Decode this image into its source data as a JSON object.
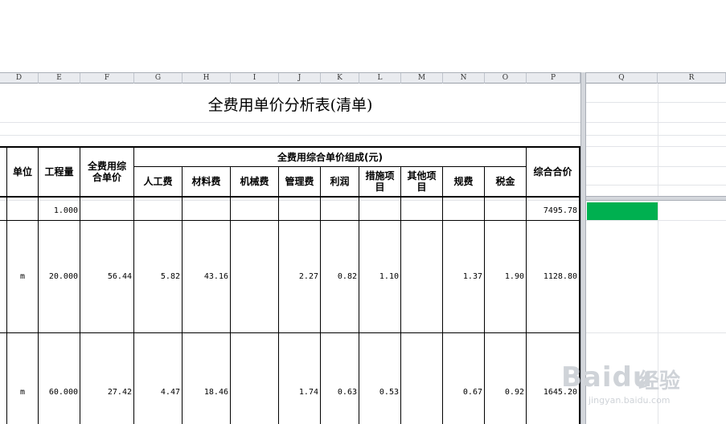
{
  "sheet": {
    "columns_left": [
      "D",
      "E",
      "F",
      "G",
      "H",
      "I",
      "J",
      "K",
      "L",
      "M",
      "N",
      "O",
      "P"
    ],
    "columns_right": [
      "Q",
      "R"
    ],
    "title": "全费用单价分析表(清单)",
    "headers": {
      "unit": "单位",
      "quantity": "工程量",
      "full_unit_price": "全费用综合单价",
      "composition_group": "全费用综合单价组成(元)",
      "labor": "人工费",
      "material": "材料费",
      "machinery": "机械费",
      "management": "管理费",
      "profit": "利润",
      "measures": "措施项目",
      "other": "其他项目",
      "fees": "规费",
      "tax": "税金",
      "total": "综合合价"
    },
    "rows": [
      {
        "unit": "",
        "quantity": "1.000",
        "full_unit_price": "",
        "labor": "",
        "material": "",
        "machinery": "",
        "management": "",
        "profit": "",
        "measures": "",
        "other": "",
        "fees": "",
        "tax": "",
        "total": "7495.78"
      },
      {
        "unit": "m",
        "quantity": "20.000",
        "full_unit_price": "56.44",
        "labor": "5.82",
        "material": "43.16",
        "machinery": "",
        "management": "2.27",
        "profit": "0.82",
        "measures": "1.10",
        "other": "",
        "fees": "1.37",
        "tax": "1.90",
        "total": "1128.80"
      },
      {
        "unit": "m",
        "quantity": "60.000",
        "full_unit_price": "27.42",
        "labor": "4.47",
        "material": "18.46",
        "machinery": "",
        "management": "1.74",
        "profit": "0.63",
        "measures": "0.53",
        "other": "",
        "fees": "0.67",
        "tax": "0.92",
        "total": "1645.20"
      }
    ],
    "selected_cell_color": "#00b050"
  },
  "watermark": {
    "logo": "Baidu",
    "cn": "经验",
    "url": "jingyan.baidu.com"
  }
}
